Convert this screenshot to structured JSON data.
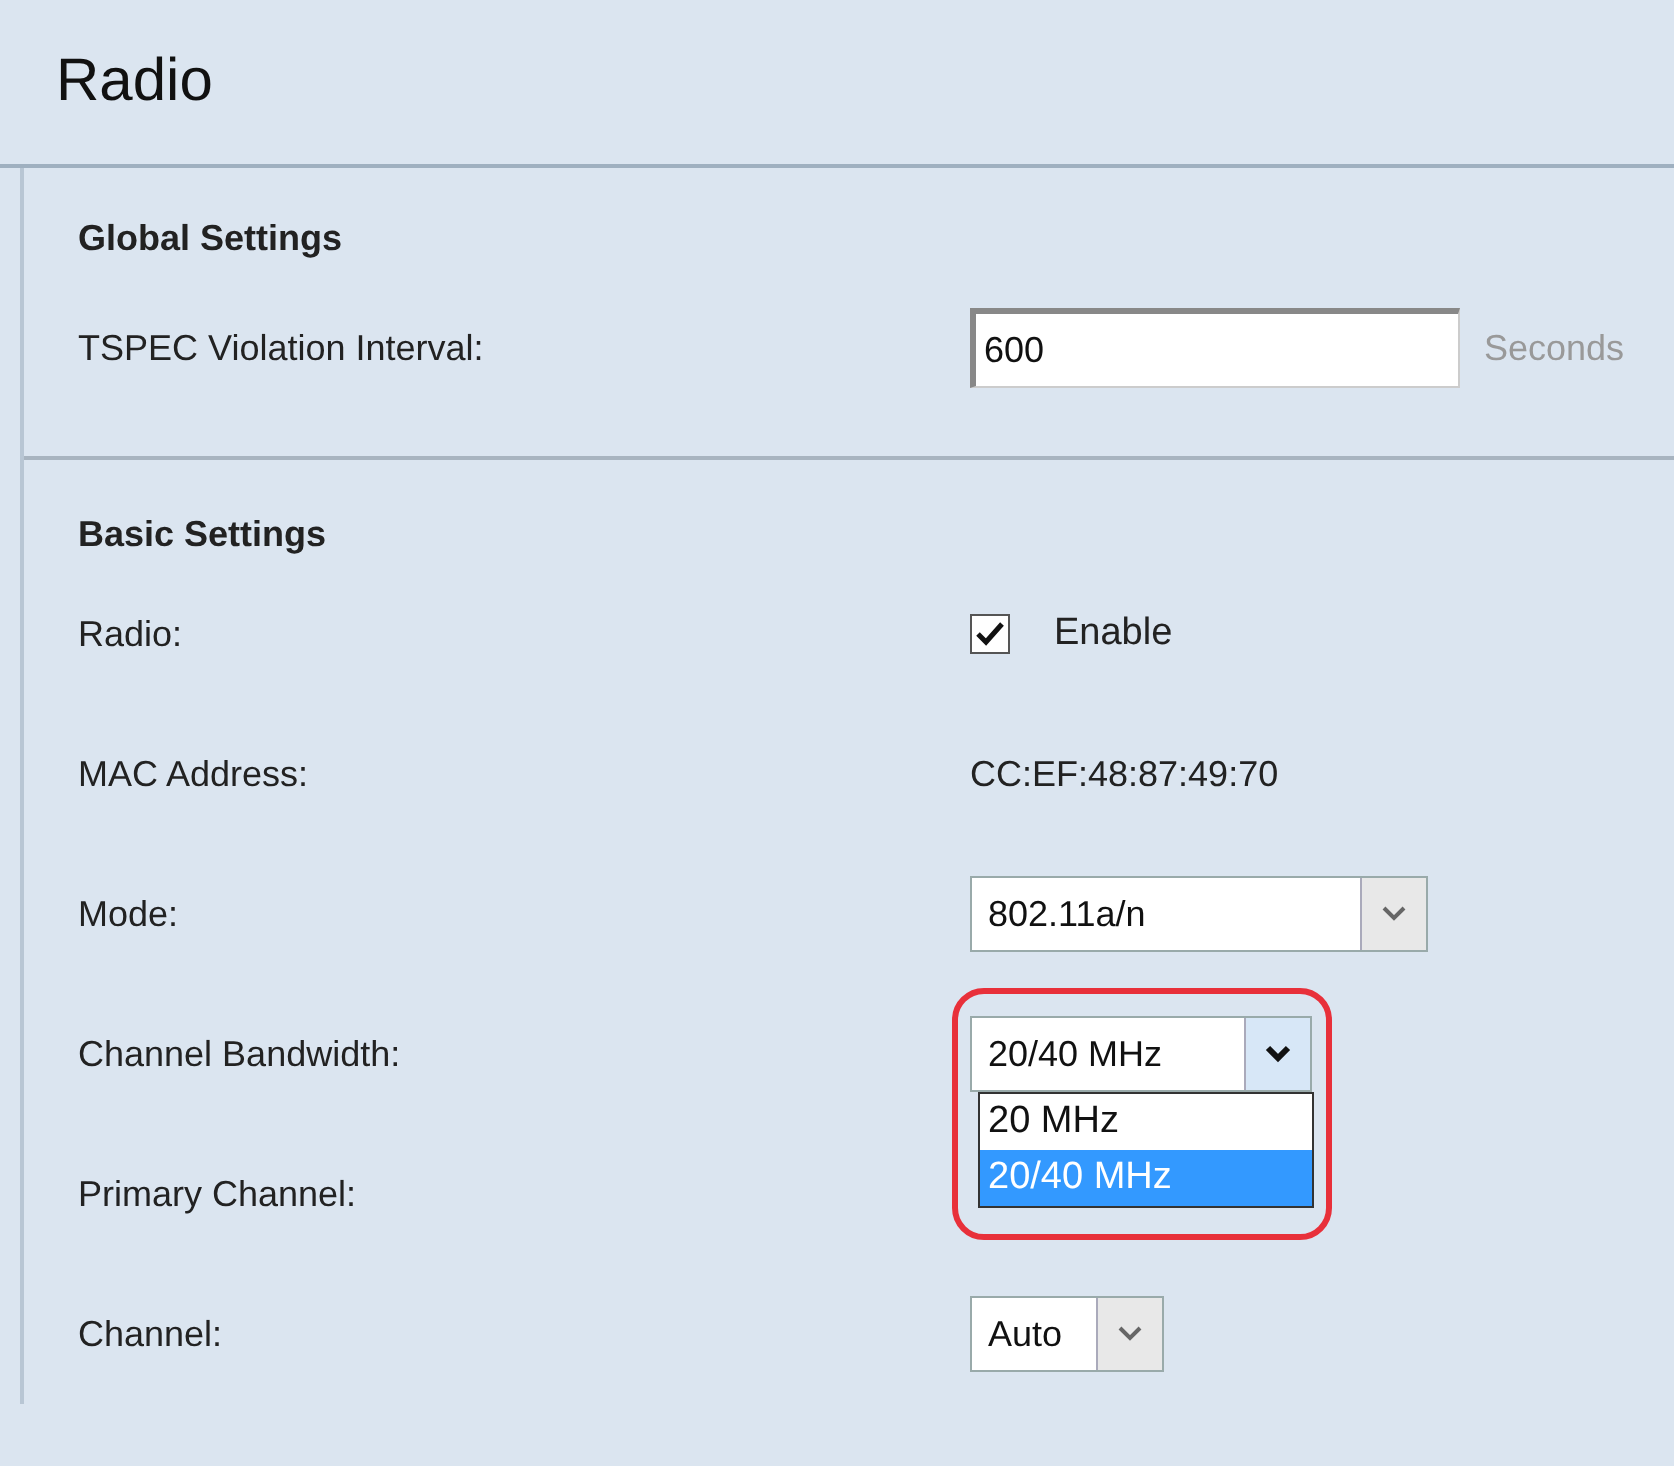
{
  "header": {
    "title": "Radio"
  },
  "global_settings": {
    "title": "Global Settings",
    "tspec": {
      "label": "TSPEC Violation Interval:",
      "value": "600",
      "unit": "Seconds"
    }
  },
  "basic_settings": {
    "title": "Basic Settings",
    "radio": {
      "label": "Radio:",
      "checked": true,
      "option": "Enable"
    },
    "mac": {
      "label": "MAC Address:",
      "value": "CC:EF:48:87:49:70"
    },
    "mode": {
      "label": "Mode:",
      "value": "802.11a/n"
    },
    "bandwidth": {
      "label": "Channel Bandwidth:",
      "value": "20/40 MHz",
      "expanded": true,
      "highlighted": true,
      "options": [
        {
          "label": "20 MHz",
          "selected": false
        },
        {
          "label": "20/40 MHz",
          "selected": true
        }
      ]
    },
    "primary_channel": {
      "label": "Primary Channel:"
    },
    "channel": {
      "label": "Channel:",
      "value": "Auto"
    }
  }
}
